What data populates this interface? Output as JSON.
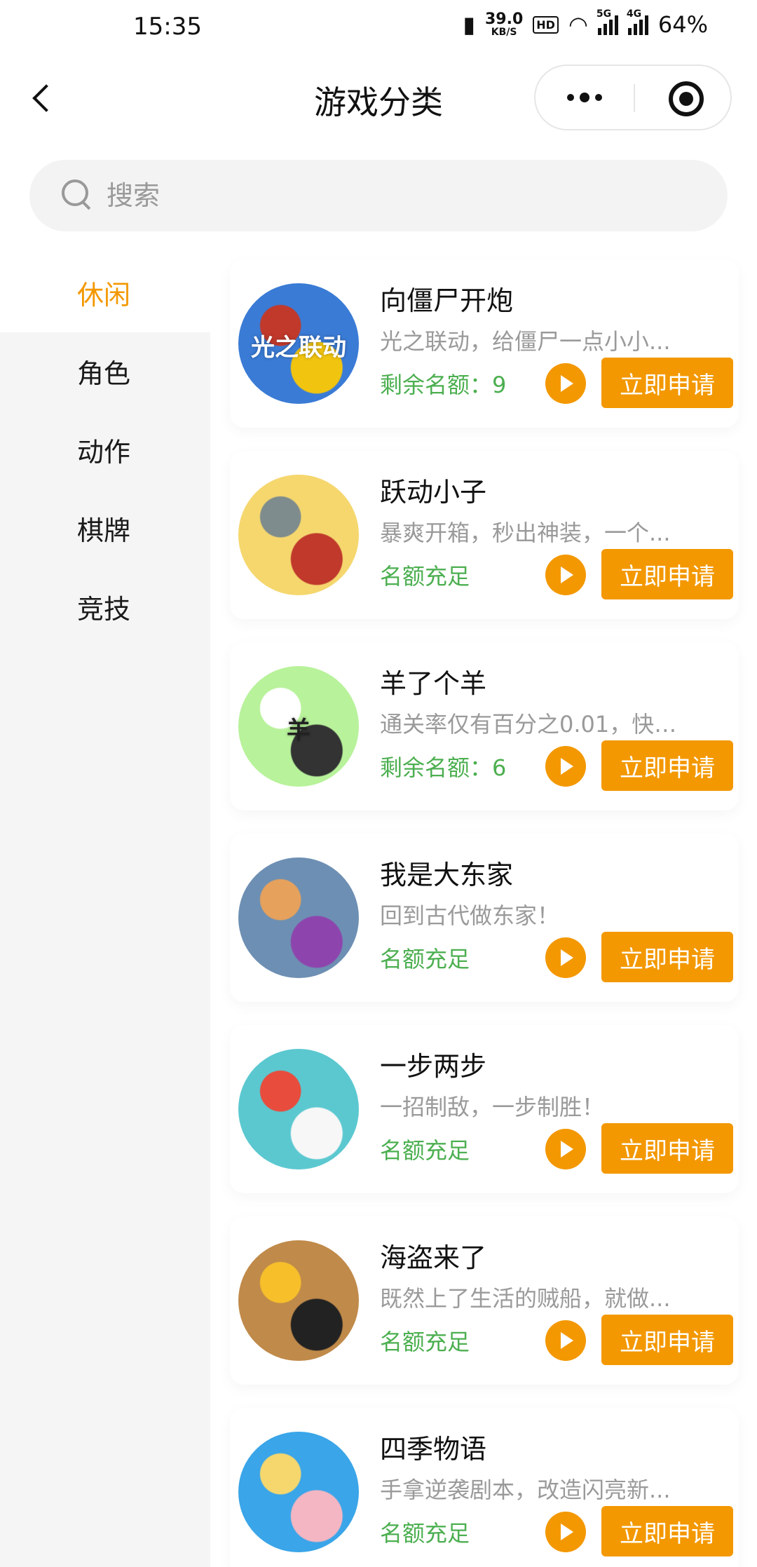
{
  "status_bar": {
    "time": "15:35",
    "speed_value": "39.0",
    "speed_unit": "KB/S",
    "hd_badge": "HD",
    "net_5g": "5G",
    "net_4g": "4G",
    "battery": "64%"
  },
  "nav": {
    "title": "游戏分类",
    "back_icon": "back-arrow-icon",
    "more_icon": "more-dots-icon",
    "close_icon": "target-close-icon"
  },
  "search": {
    "placeholder": "搜索",
    "icon": "search-icon"
  },
  "categories": [
    {
      "label": "休闲",
      "active": true
    },
    {
      "label": "角色",
      "active": false
    },
    {
      "label": "动作",
      "active": false
    },
    {
      "label": "棋牌",
      "active": false
    },
    {
      "label": "竞技",
      "active": false
    }
  ],
  "games": [
    {
      "name": "向僵尸开炮",
      "desc": "光之联动，给僵尸一点小小...",
      "quota": "剩余名额：9",
      "apply": "立即申请",
      "icon_colors": [
        "#3a7bd5",
        "#c0392b",
        "#f1c40f"
      ],
      "icon_text": "光之联动"
    },
    {
      "name": "跃动小子",
      "desc": "暴爽开箱，秒出神装，一个...",
      "quota": "名额充足",
      "apply": "立即申请",
      "icon_colors": [
        "#f5d76e",
        "#7f8c8d",
        "#c0392b"
      ],
      "icon_text": ""
    },
    {
      "name": "羊了个羊",
      "desc": "通关率仅有百分之0.01，快来...",
      "quota": "剩余名额：6",
      "apply": "立即申请",
      "icon_colors": [
        "#b8f29b",
        "#ffffff",
        "#333333"
      ],
      "icon_text": "羊"
    },
    {
      "name": "我是大东家",
      "desc": "回到古代做东家！",
      "quota": "名额充足",
      "apply": "立即申请",
      "icon_colors": [
        "#6d8fb3",
        "#e6a15c",
        "#8e44ad"
      ],
      "icon_text": ""
    },
    {
      "name": "一步两步",
      "desc": "一招制敌，一步制胜！",
      "quota": "名额充足",
      "apply": "立即申请",
      "icon_colors": [
        "#5bc8d0",
        "#e74c3c",
        "#f7f7f7"
      ],
      "icon_text": ""
    },
    {
      "name": "海盗来了",
      "desc": "既然上了生活的贼船，就做...",
      "quota": "名额充足",
      "apply": "立即申请",
      "icon_colors": [
        "#c08a4a",
        "#f7c02b",
        "#222222"
      ],
      "icon_text": ""
    },
    {
      "name": "四季物语",
      "desc": "手拿逆袭剧本，改造闪亮新...",
      "quota": "名额充足",
      "apply": "立即申请",
      "icon_colors": [
        "#3aa5e8",
        "#f5d76e",
        "#f4b6c2"
      ],
      "icon_text": ""
    }
  ],
  "colors": {
    "accent": "#f39800",
    "quota_green": "#4caf50",
    "sidebar_bg": "#f5f5f5",
    "desc_gray": "#9a9a9a"
  }
}
